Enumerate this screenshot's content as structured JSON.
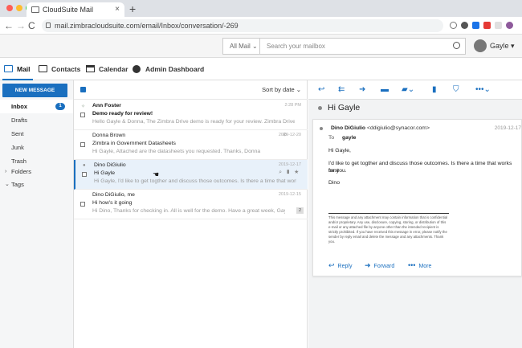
{
  "browser": {
    "tab_title": "CloudSuite Mail",
    "tab_close": "×",
    "new_tab": "+",
    "url": "mail.zimbracloudsuite.com/email/Inbox/conversation/-269",
    "nav": {
      "back": "←",
      "forward": "→",
      "reload": "C"
    }
  },
  "header": {
    "search_scope": "All Mail",
    "search_placeholder": "Search your mailbox",
    "user_name": "Gayle"
  },
  "nav_tabs": [
    {
      "label": "Mail",
      "icon": "envelope-icon"
    },
    {
      "label": "Contacts",
      "icon": "contacts-icon"
    },
    {
      "label": "Calendar",
      "icon": "calendar-icon"
    },
    {
      "label": "Admin Dashboard",
      "icon": "admin-icon"
    }
  ],
  "sidebar": {
    "new_message": "NEW MESSAGE",
    "folders": [
      {
        "label": "Inbox",
        "count": "1"
      },
      {
        "label": "Drafts"
      },
      {
        "label": "Sent"
      },
      {
        "label": "Junk"
      },
      {
        "label": "Trash"
      },
      {
        "label": "Folders"
      },
      {
        "label": "Tags"
      }
    ]
  },
  "list": {
    "sort_label": "Sort by date",
    "messages": [
      {
        "from": "Ann Foster",
        "subject": "Demo ready for review!",
        "preview": "Hello Gayle & Donna,   The Zimbra Drive demo is ready for your review.   Zimbra Drive De...",
        "date": "2:28 PM"
      },
      {
        "from": "Donna Brown",
        "subject": "Zimbra in Government Datasheets",
        "preview": "Hi Gayle,   Attached are the datasheets you requested.   Thanks, Donna",
        "date": "2019-12-20"
      },
      {
        "from": "Dino DiGiulio",
        "subject": "Hi Gayle",
        "preview": "Hi Gayle,   I'd like to get togther and discuss those outcomes. Is there a time that works bes...",
        "date": "2019-12-17"
      },
      {
        "from": "Dino DiGiulio, me",
        "subject": "Hi how's it going",
        "preview": "Hi Dino,   Thanks for checking in. All is well for the demo.   Have a great week, Gayle ...",
        "date": "2019-12-15",
        "count": "2"
      }
    ]
  },
  "reader": {
    "subject": "Hi Gayle",
    "sender": "Dino DiGiulio",
    "sender_email": "<ddigiulio@synacor.com>",
    "date": "2019-12-17",
    "to_label": "To",
    "to_value": "gayle",
    "greeting": "Hi Gayle,",
    "body_line1": "I'd like to get togther and discuss those outcomes. Is there a time that works best",
    "body_line2": "for you.",
    "signature": "Dino",
    "legal": "This message and any attachment may contain information that is confidential and/or proprietary. Any use, disclosure, copying, storing, or distribution of this e-mail or any attached file by anyone other than the intended recipient is strictly prohibited. If you have received this message in error, please notify the sender by reply email and delete the message and any attachments. Thank you.",
    "reply": "Reply",
    "forward": "Forward",
    "more": "More"
  },
  "colors": {
    "accent": "#1a6fbf",
    "selected_row": "#e8f1fa"
  }
}
